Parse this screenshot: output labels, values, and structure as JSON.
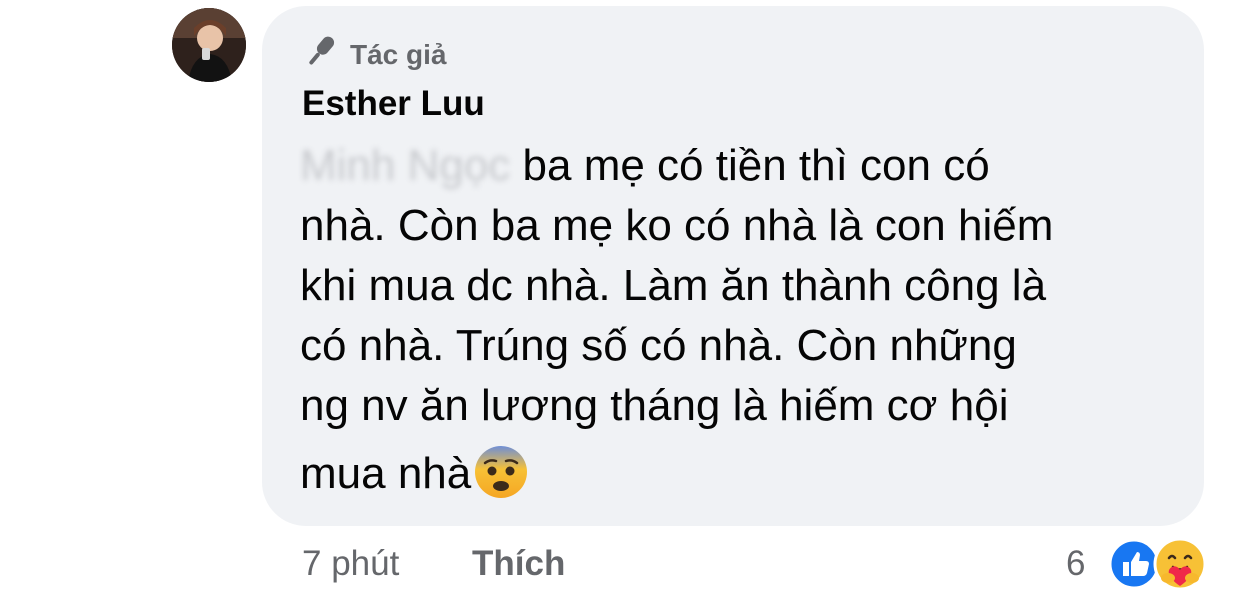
{
  "comment": {
    "badge_label": "Tác giả",
    "author_name": "Esther Luu",
    "mention": "Minh Ngọc",
    "body_lines": [
      " ba mẹ có tiền thì con có",
      "nhà. Còn ba mẹ ko có nhà là con hiếm",
      "khi mua dc nhà. Làm ăn thành công là",
      "có nhà. Trúng số có nhà. Còn những",
      "ng nv ăn lương tháng là hiếm cơ hội"
    ],
    "last_line": "mua nhà",
    "emoji": "anxious-face",
    "timestamp": "7 phút",
    "like_label": "Thích",
    "reaction_count": "6",
    "reactions": [
      "like-icon",
      "care-icon"
    ],
    "colors": {
      "bubble": "#f0f2f5",
      "secondary_text": "#65676b",
      "primary_text": "#050505",
      "like_blue": "#1877f2",
      "care_yellow": "#f7c136"
    }
  }
}
